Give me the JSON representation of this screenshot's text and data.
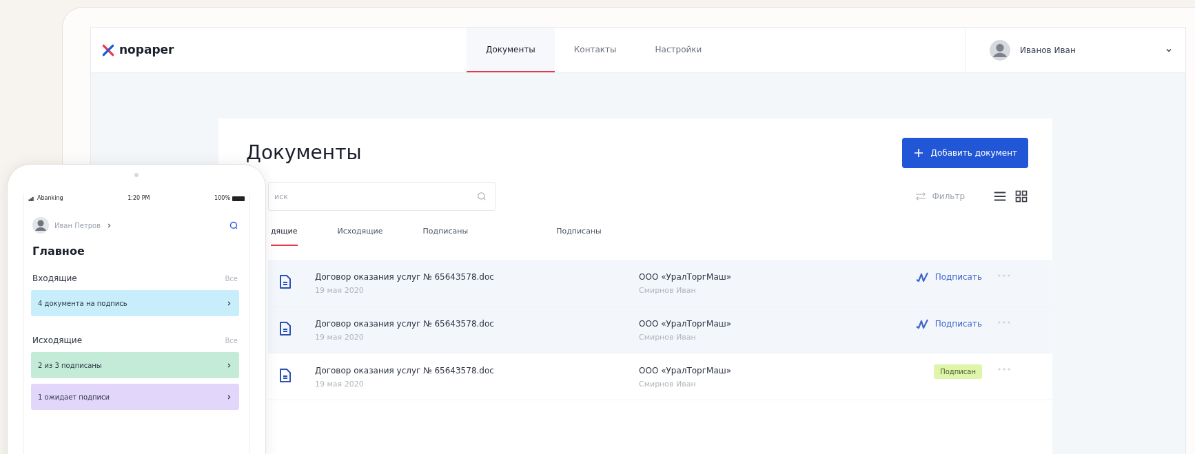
{
  "header": {
    "logo": "nopaper",
    "nav": [
      {
        "label": "Документы",
        "selected": true
      },
      {
        "label": "Контакты",
        "selected": false
      },
      {
        "label": "Настройки",
        "selected": false
      }
    ],
    "user": {
      "name": "Иванов Иван"
    }
  },
  "page": {
    "title": "Документы",
    "add_button": "Добавить документ",
    "search": {
      "placeholder": "иск"
    },
    "filter": "Фильтр",
    "tabs": [
      {
        "label": "дящие",
        "selected": true
      },
      {
        "label": "Исходящие",
        "selected": false
      },
      {
        "label": "Подписаны",
        "selected": false
      },
      {
        "label": "Подписаны",
        "selected": false
      }
    ],
    "documents": [
      {
        "name": "Договор оказания услуг № 65643578.doc",
        "date": "19 мая 2020",
        "company": "ООО «УралТоргМаш»",
        "person": "Смирнов Иван",
        "highlighted": true,
        "action": {
          "kind": "sign",
          "label": "Подписать"
        }
      },
      {
        "name": "Договор оказания услуг № 65643578.doc",
        "date": "19 мая 2020",
        "company": "ООО «УралТоргМаш»",
        "person": "Смирнов Иван",
        "highlighted": true,
        "action": {
          "kind": "sign",
          "label": "Подписать"
        }
      },
      {
        "name": "Договор оказания услуг № 65643578.doc",
        "date": "19 мая 2020",
        "company": "ООО «УралТоргМаш»",
        "person": "Смирнов Иван",
        "highlighted": false,
        "action": {
          "kind": "badge",
          "label": "Подписан"
        }
      }
    ]
  },
  "phone": {
    "status": {
      "carrier": "Abanking",
      "time": "1:20 PM",
      "battery": "100%"
    },
    "user": "Иван Петров",
    "title": "Главное",
    "sections": [
      {
        "title": "Входящие",
        "all": "Все",
        "cards": [
          {
            "text": "4 документа на подпись",
            "color": "#c9eefb"
          }
        ]
      },
      {
        "title": "Исходящие",
        "all": "Все",
        "cards": [
          {
            "text": "2 из 3 подписаны",
            "color": "#c3ebd8"
          },
          {
            "text": "1 ожидает подписи",
            "color": "#e2d6fb"
          }
        ]
      }
    ]
  }
}
